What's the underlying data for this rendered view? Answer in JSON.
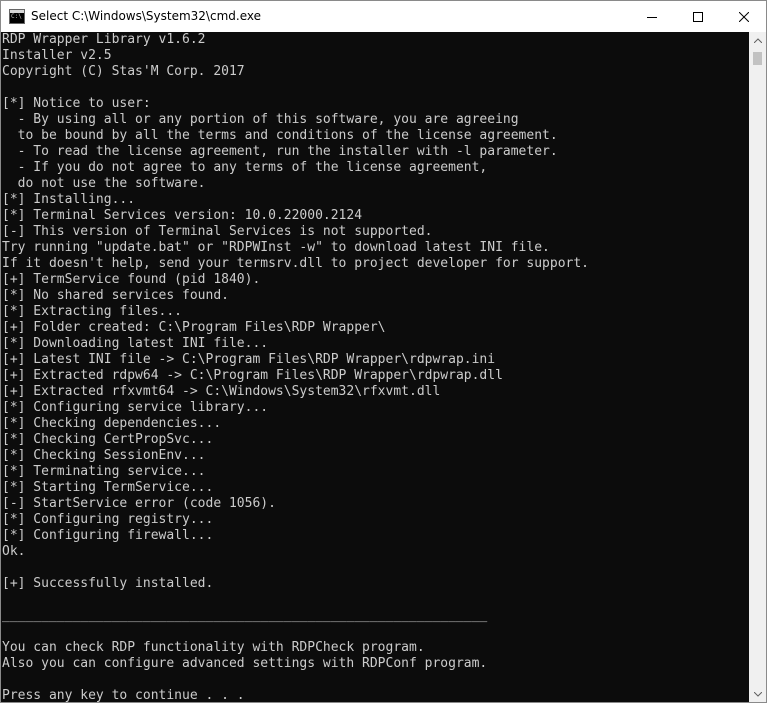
{
  "window": {
    "title": "Select C:\\Windows\\System32\\cmd.exe",
    "icon_text": "C:\\"
  },
  "controls": {
    "minimize_icon": "minimize-icon",
    "maximize_icon": "maximize-icon",
    "close_icon": "close-icon"
  },
  "console": {
    "background": "#0c0c0c",
    "foreground": "#cccccc",
    "lines": [
      "RDP Wrapper Library v1.6.2",
      "Installer v2.5",
      "Copyright (C) Stas'M Corp. 2017",
      "",
      "[*] Notice to user:",
      "  - By using all or any portion of this software, you are agreeing",
      "  to be bound by all the terms and conditions of the license agreement.",
      "  - To read the license agreement, run the installer with -l parameter.",
      "  - If you do not agree to any terms of the license agreement,",
      "  do not use the software.",
      "[*] Installing...",
      "[*] Terminal Services version: 10.0.22000.2124",
      "[-] This version of Terminal Services is not supported.",
      "Try running \"update.bat\" or \"RDPWInst -w\" to download latest INI file.",
      "If it doesn't help, send your termsrv.dll to project developer for support.",
      "[+] TermService found (pid 1840).",
      "[*] No shared services found.",
      "[*] Extracting files...",
      "[+] Folder created: C:\\Program Files\\RDP Wrapper\\",
      "[*] Downloading latest INI file...",
      "[+] Latest INI file -> C:\\Program Files\\RDP Wrapper\\rdpwrap.ini",
      "[+] Extracted rdpw64 -> C:\\Program Files\\RDP Wrapper\\rdpwrap.dll",
      "[+] Extracted rfxvmt64 -> C:\\Windows\\System32\\rfxvmt.dll",
      "[*] Configuring service library...",
      "[*] Checking dependencies...",
      "[*] Checking CertPropSvc...",
      "[*] Checking SessionEnv...",
      "[*] Terminating service...",
      "[*] Starting TermService...",
      "[-] StartService error (code 1056).",
      "[*] Configuring registry...",
      "[*] Configuring firewall...",
      "Ok.",
      "",
      "[+] Successfully installed.",
      "",
      "______________________________________________________________",
      "",
      "You can check RDP functionality with RDPCheck program.",
      "Also you can configure advanced settings with RDPConf program.",
      "",
      "Press any key to continue . . ."
    ]
  }
}
